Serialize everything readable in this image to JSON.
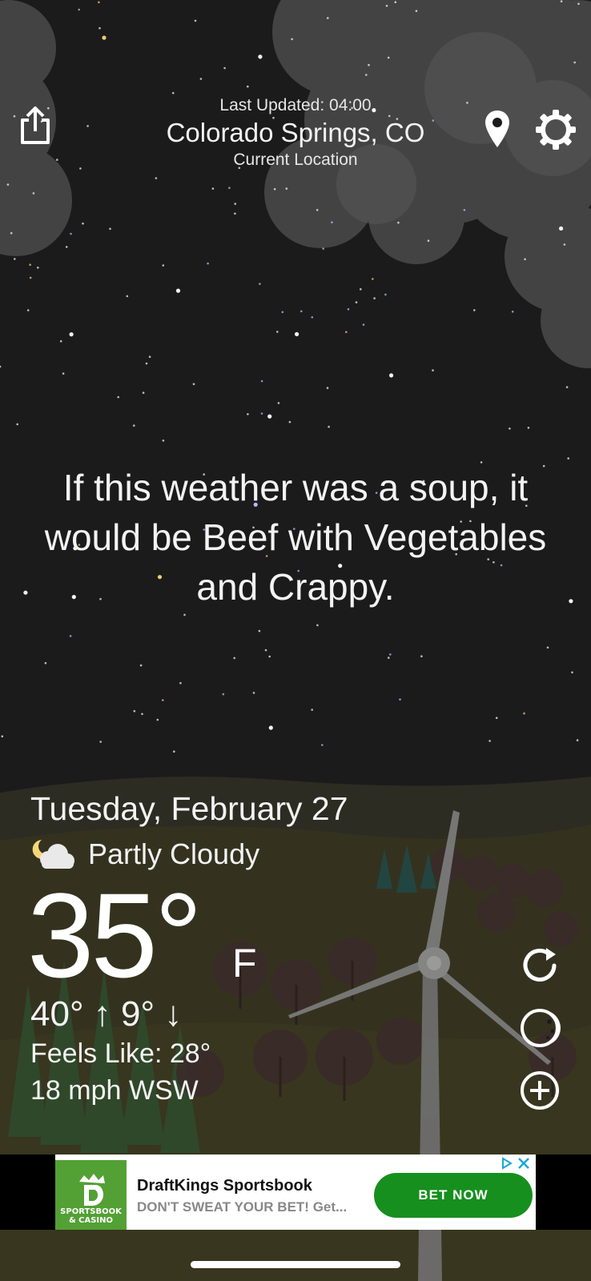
{
  "header": {
    "last_updated": "Last Updated: 04:00",
    "location": "Colorado Springs, CO",
    "location_sub": "Current Location",
    "icons": [
      "share-icon",
      "location-pin-icon",
      "gear-icon"
    ]
  },
  "quote": "If this weather was a soup, it would be Beef with Vegetables and Crappy.",
  "weather": {
    "date": "Tuesday, February 27",
    "condition": "Partly Cloudy",
    "condition_icon": "partly-cloudy-night-icon",
    "temperature": "35°",
    "unit": "F",
    "high": "40°",
    "low": "9°",
    "feels_like": "Feels Like: 28°",
    "wind": "18 mph WSW"
  },
  "side_actions": [
    "refresh-icon",
    "moon-phase-icon",
    "add-icon"
  ],
  "ad": {
    "logo_text_1": "SPORTSBOOK",
    "logo_text_2": "& CASINO",
    "title": "DraftKings Sportsbook",
    "subtitle": "DON'T SWEAT YOUR BET! Get...",
    "cta": "BET NOW"
  },
  "colors": {
    "sky": "#1b1b1c",
    "ground": "#34321f",
    "cta_green": "#168f1e",
    "logo_green": "#53a035"
  }
}
